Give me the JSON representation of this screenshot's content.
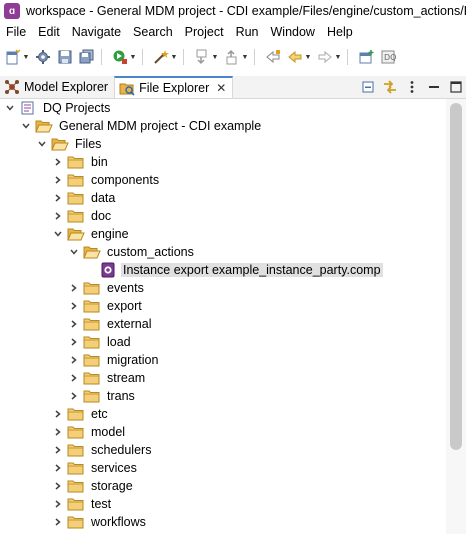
{
  "window": {
    "title": "workspace - General MDM project - CDI example/Files/engine/custom_actions/Insta"
  },
  "menu": [
    "File",
    "Edit",
    "Navigate",
    "Search",
    "Project",
    "Run",
    "Window",
    "Help"
  ],
  "tabs": [
    {
      "label": "Model Explorer",
      "icon": "model-explorer-icon",
      "active": false
    },
    {
      "label": "File Explorer",
      "icon": "file-explorer-icon",
      "active": true,
      "close": "✕"
    }
  ],
  "tree": [
    {
      "label": "DQ Projects",
      "depth": 0,
      "expanded": true,
      "icon": "project-root-icon"
    },
    {
      "label": "General MDM project - CDI example",
      "depth": 1,
      "expanded": true,
      "icon": "folder-open-icon"
    },
    {
      "label": "Files",
      "depth": 2,
      "expanded": true,
      "icon": "folder-open-icon"
    },
    {
      "label": "bin",
      "depth": 3,
      "expanded": false,
      "icon": "folder-icon"
    },
    {
      "label": "components",
      "depth": 3,
      "expanded": false,
      "icon": "folder-icon"
    },
    {
      "label": "data",
      "depth": 3,
      "expanded": false,
      "icon": "folder-icon"
    },
    {
      "label": "doc",
      "depth": 3,
      "expanded": false,
      "icon": "folder-icon"
    },
    {
      "label": "engine",
      "depth": 3,
      "expanded": true,
      "icon": "folder-open-icon"
    },
    {
      "label": "custom_actions",
      "depth": 4,
      "expanded": true,
      "icon": "folder-open-icon"
    },
    {
      "label": "Instance export example_instance_party.comp",
      "depth": 5,
      "leaf": true,
      "selected": true,
      "icon": "component-file-icon"
    },
    {
      "label": "events",
      "depth": 4,
      "expanded": false,
      "icon": "folder-icon"
    },
    {
      "label": "export",
      "depth": 4,
      "expanded": false,
      "icon": "folder-icon"
    },
    {
      "label": "external",
      "depth": 4,
      "expanded": false,
      "icon": "folder-icon"
    },
    {
      "label": "load",
      "depth": 4,
      "expanded": false,
      "icon": "folder-icon"
    },
    {
      "label": "migration",
      "depth": 4,
      "expanded": false,
      "icon": "folder-icon"
    },
    {
      "label": "stream",
      "depth": 4,
      "expanded": false,
      "icon": "folder-icon"
    },
    {
      "label": "trans",
      "depth": 4,
      "expanded": false,
      "icon": "folder-icon"
    },
    {
      "label": "etc",
      "depth": 3,
      "expanded": false,
      "icon": "folder-icon"
    },
    {
      "label": "model",
      "depth": 3,
      "expanded": false,
      "icon": "folder-icon"
    },
    {
      "label": "schedulers",
      "depth": 3,
      "expanded": false,
      "icon": "folder-icon"
    },
    {
      "label": "services",
      "depth": 3,
      "expanded": false,
      "icon": "folder-icon"
    },
    {
      "label": "storage",
      "depth": 3,
      "expanded": false,
      "icon": "folder-icon"
    },
    {
      "label": "test",
      "depth": 3,
      "expanded": false,
      "icon": "folder-icon"
    },
    {
      "label": "workflows",
      "depth": 3,
      "expanded": false,
      "icon": "folder-icon"
    }
  ],
  "colors": {
    "logo": "#8e3c96",
    "folder": "#e8b44a",
    "selection": "#e0e0e0",
    "tab_accent": "#4a84c9"
  }
}
